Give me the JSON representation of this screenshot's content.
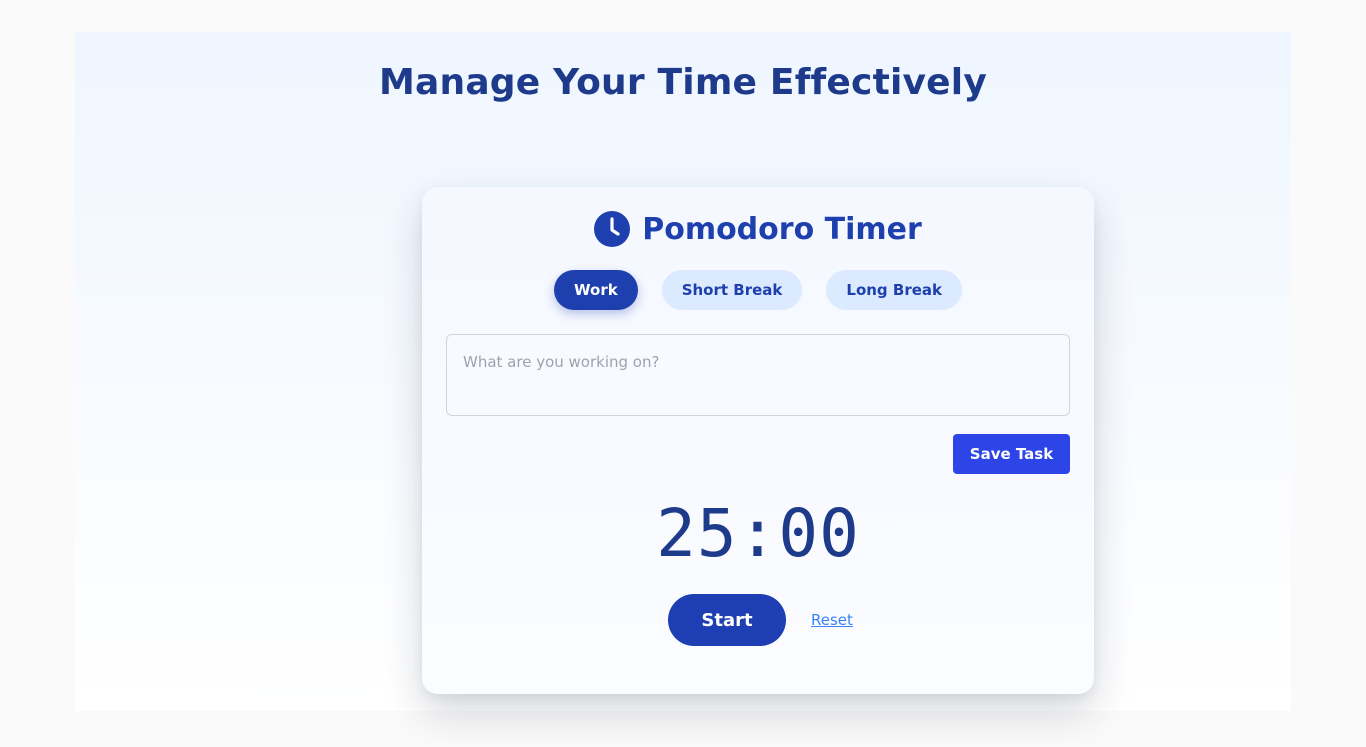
{
  "page": {
    "title": "Manage Your Time Effectively"
  },
  "timer_card": {
    "icon": "clock-icon",
    "title": "Pomodoro Timer",
    "modes": [
      {
        "label": "Work",
        "active": true
      },
      {
        "label": "Short Break",
        "active": false
      },
      {
        "label": "Long Break",
        "active": false
      }
    ],
    "task_input": {
      "value": "",
      "placeholder": "What are you working on?"
    },
    "save_label": "Save Task",
    "time_display": "25:00",
    "start_label": "Start",
    "reset_label": "Reset"
  },
  "colors": {
    "primary": "#1e40af",
    "heading": "#1e3a8a",
    "save_button": "#2d44e6",
    "mode_inactive_bg": "#dbeafe",
    "link": "#3b82f6"
  }
}
